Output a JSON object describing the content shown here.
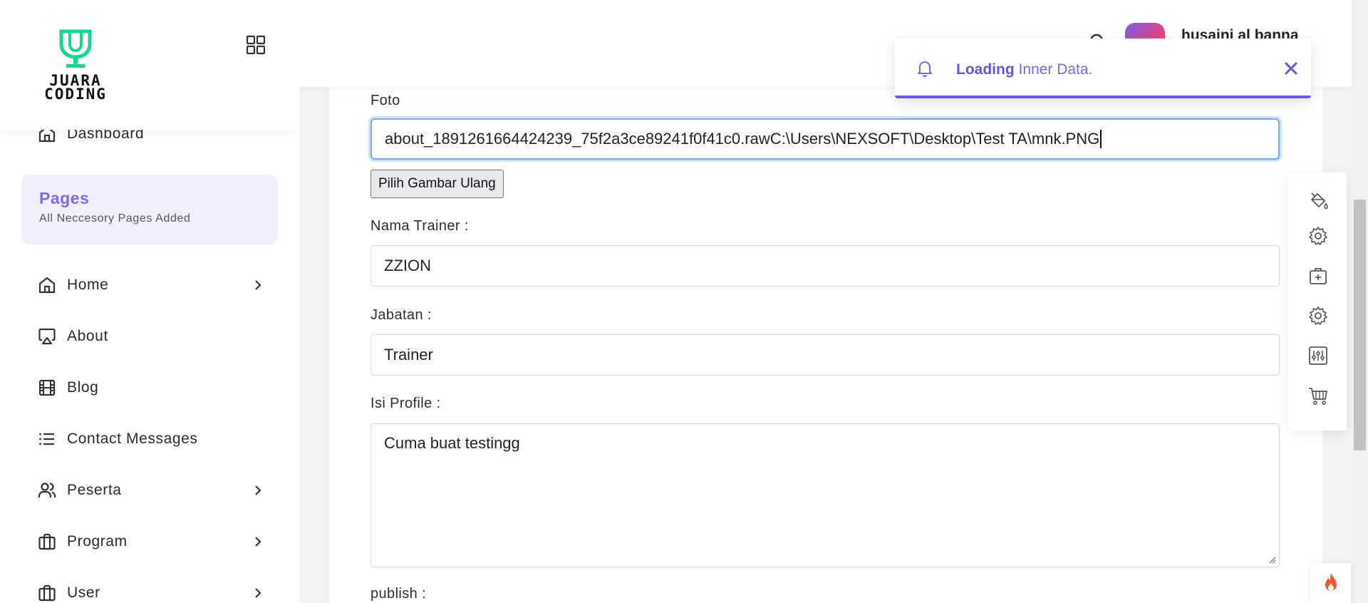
{
  "brand": {
    "logo_line1": "JUARA",
    "logo_line2": "CODING",
    "accent": "#19d68a"
  },
  "sidebar": {
    "dashboard_label": "Dashboard",
    "pages_card": {
      "title": "Pages",
      "subtitle": "All Neccesory Pages Added"
    },
    "items": [
      {
        "label": "Home",
        "icon": "home-icon",
        "has_submenu": true
      },
      {
        "label": "About",
        "icon": "airplay-icon",
        "has_submenu": false
      },
      {
        "label": "Blog",
        "icon": "film-icon",
        "has_submenu": false
      },
      {
        "label": "Contact Messages",
        "icon": "list-icon",
        "has_submenu": false
      },
      {
        "label": "Peserta",
        "icon": "users-icon",
        "has_submenu": true
      },
      {
        "label": "Program",
        "icon": "briefcase-icon",
        "has_submenu": true
      },
      {
        "label": "User",
        "icon": "briefcase-icon",
        "has_submenu": true
      }
    ]
  },
  "header": {
    "user_name": "husaini al banna"
  },
  "toast": {
    "bold": "Loading",
    "text": " Inner Data.",
    "accent": "#7256e8"
  },
  "form": {
    "foto": {
      "label": "Foto",
      "value": "about_1891261664424239_75f2a3ce89241f0f41c0.rawC:\\Users\\NEXSOFT\\Desktop\\Test TA\\mnk.PNG"
    },
    "pick_button": "Pilih Gambar Ulang",
    "nama_trainer": {
      "label": "Nama Trainer :",
      "value": "ZZION"
    },
    "jabatan": {
      "label": "Jabatan :",
      "value": "Trainer"
    },
    "isi_profile": {
      "label": "Isi Profile :",
      "value": "Cuma buat testingg"
    },
    "publish": {
      "label": "publish :"
    }
  },
  "tools": [
    "paint-bucket-icon",
    "gear-icon",
    "medical-box-icon",
    "gear-icon",
    "sliders-icon",
    "cart-icon"
  ],
  "colors": {
    "purple": "#7b5ce6",
    "sidebar_card_bg": "#f1effd"
  }
}
